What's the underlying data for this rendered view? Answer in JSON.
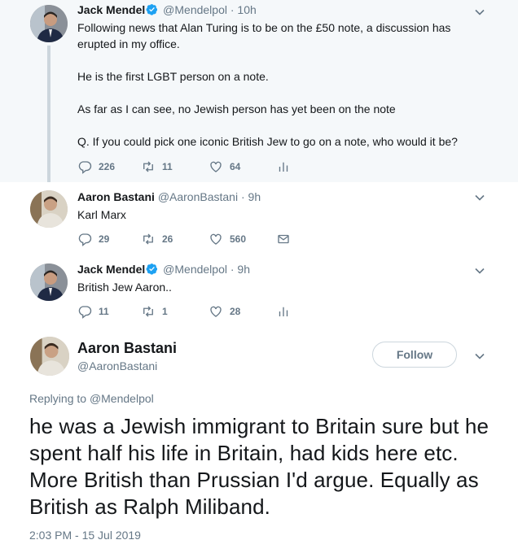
{
  "colors": {
    "text": "#14171a",
    "muted": "#657786",
    "link": "#1da1f2",
    "highlight_bg": "#f5f8fa",
    "thread_line": "#ccd6dd"
  },
  "tweet1": {
    "name": "Jack Mendel",
    "handle": "@Mendelpol",
    "time": "10h",
    "verified": true,
    "text": [
      "Following news that Alan Turing is to be on the £50 note, a discussion has erupted in my office.",
      "He is the first LGBT person on a note.",
      "As far as I can see, no Jewish person has yet been on the note",
      "Q. If you could pick one iconic British Jew to go on a note, who would it be?"
    ],
    "replies": "226",
    "retweets": "11",
    "likes": "64",
    "extra_icon": "analytics-icon"
  },
  "tweet2": {
    "name": "Aaron Bastani",
    "handle": "@AaronBastani",
    "time": "9h",
    "text": "Karl Marx",
    "replies": "29",
    "retweets": "26",
    "likes": "560",
    "extra_icon": "direct-message-icon"
  },
  "tweet3": {
    "name": "Jack Mendel",
    "handle": "@Mendelpol",
    "time": "9h",
    "verified": true,
    "text": "British Jew Aaron..",
    "replies": "11",
    "retweets": "1",
    "likes": "28",
    "extra_icon": "analytics-icon"
  },
  "main": {
    "name": "Aaron Bastani",
    "handle": "@AaronBastani",
    "follow_label": "Follow",
    "replying_prefix": "Replying to",
    "replying_to": "@Mendelpol",
    "text": "he was a Jewish immigrant to Britain sure but he spent half his life in Britain, had kids here etc. More British than Prussian I'd argue. Equally as British as Ralph Miliband.",
    "timestamp": "2:03 PM - 15 Jul 2019"
  },
  "separator": "·"
}
